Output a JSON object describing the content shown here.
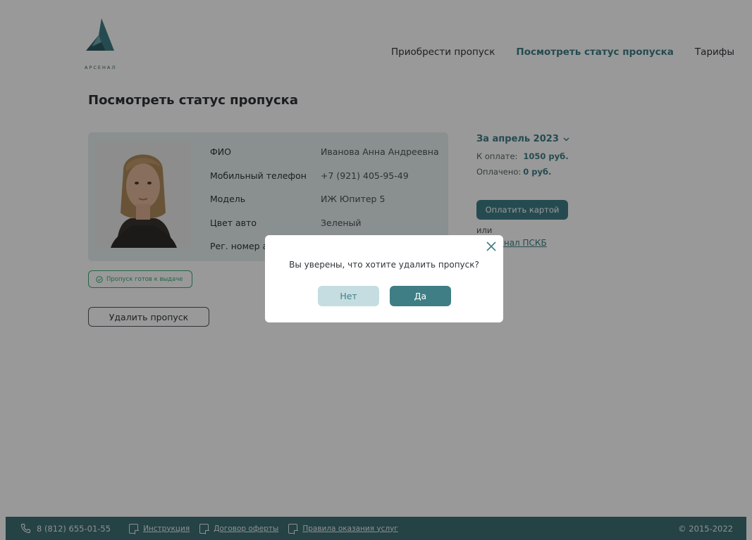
{
  "brand": {
    "name": "АРСЕНАЛ",
    "color": "#3f7e85"
  },
  "nav": {
    "items": [
      {
        "label": "Приобрести пропуск"
      },
      {
        "label": "Посмотреть статус пропуска",
        "active": true
      },
      {
        "label": "Тарифы"
      }
    ]
  },
  "page": {
    "title": "Посмотреть статус пропуска"
  },
  "pass": {
    "fields": [
      {
        "label": "ФИО",
        "value": "Иванова Анна Андреевна"
      },
      {
        "label": "Мобильный телефон",
        "value": "+7 (921) 405-95-49"
      },
      {
        "label": "Модель",
        "value": "ИЖ Юпитер 5"
      },
      {
        "label": "Цвет авто",
        "value": "Зеленый"
      },
      {
        "label": "Рег. номер авто",
        "value": ""
      }
    ],
    "status": "Пропуск готов к выдаче",
    "delete_label": "Удалить пропуск"
  },
  "payment": {
    "period": "За апрель 2023",
    "due_label": "К оплате:",
    "due_value": "1050 руб.",
    "paid_label": "Оплачено:",
    "paid_value": "0 руб.",
    "card_button": "Оплатить картой",
    "or_text": "или",
    "terminal_link": "терминал ПСКБ"
  },
  "footer": {
    "phone": "8 (812) 655-01-55",
    "links": [
      "Инструкция",
      "Договор оферты",
      "Правила оказания услуг"
    ],
    "copyright": "© 2015-2022"
  },
  "modal": {
    "question": "Вы уверены, что хотите удалить пропуск?",
    "no_label": "Нет",
    "yes_label": "Да"
  },
  "colors": {
    "accent": "#3f7e85",
    "footer": "#3f6e74",
    "status_green": "#3fa774",
    "card_bg": "#e7eeef",
    "overlay": "rgba(0,0,0,0.4)"
  }
}
